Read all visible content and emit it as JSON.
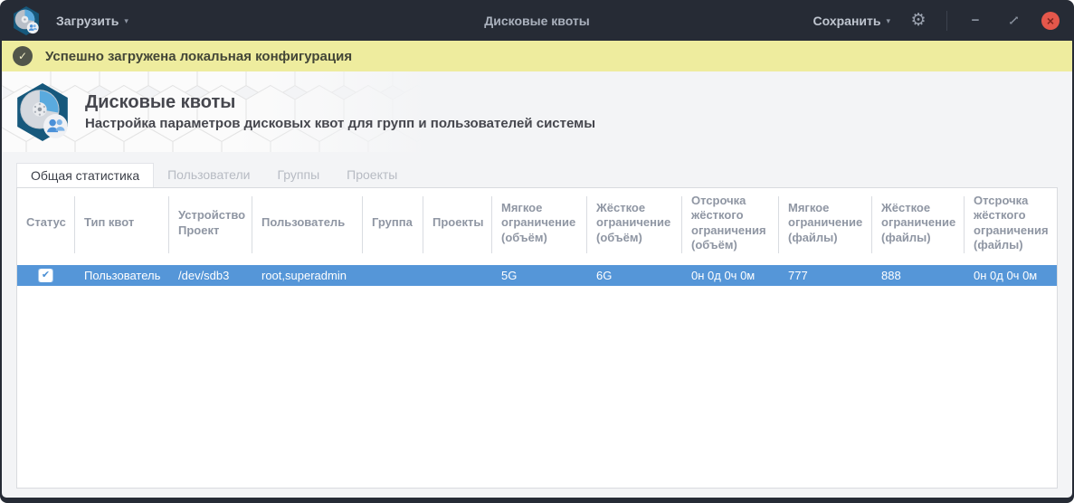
{
  "window": {
    "title": "Дисковые квоты",
    "load_label": "Загрузить",
    "save_label": "Сохранить"
  },
  "icons": {
    "dropdown": "▾",
    "gear": "⚙",
    "minimize": "−",
    "close": "×",
    "check": "✔",
    "notif_check": "✓",
    "app_logo": "disk-quota-hexagon-logo",
    "restore": "diagonal-resize-arrow"
  },
  "notification": {
    "text": "Успешно загружена локальная конфигурация"
  },
  "header": {
    "title": "Дисковые квоты",
    "subtitle": "Настройка параметров дисковых квот для групп и пользователей системы"
  },
  "tabs": [
    {
      "label": "Общая статистика",
      "active": true
    },
    {
      "label": "Пользователи",
      "active": false
    },
    {
      "label": "Группы",
      "active": false
    },
    {
      "label": "Проекты",
      "active": false
    }
  ],
  "table": {
    "columns": [
      "Статус",
      "Тип квот",
      "Устройство\nПроект",
      "Пользователь",
      "Группа",
      "Проекты",
      "Мягкое ограничение (объём)",
      "Жёсткое ограничение (объём)",
      "Отсрочка жёсткого ограничения (объём)",
      "Мягкое ограничение (файлы)",
      "Жёсткое ограничение (файлы)",
      "Отсрочка жёсткого ограничения (файлы)"
    ],
    "rows": [
      {
        "selected": true,
        "checked": true,
        "cells": [
          "Пользователь",
          "/dev/sdb3",
          "root,superadmin",
          "",
          "",
          "5G",
          "6G",
          "0н 0д 0ч 0м",
          "777",
          "888",
          "0н 0д 0ч 0м"
        ]
      }
    ]
  },
  "colors": {
    "titlebar": "#262b35",
    "accent_row": "#5596d8",
    "notification_bg": "#eeec9e",
    "close_button": "#e4574b",
    "logo_hex": "#16587c"
  }
}
